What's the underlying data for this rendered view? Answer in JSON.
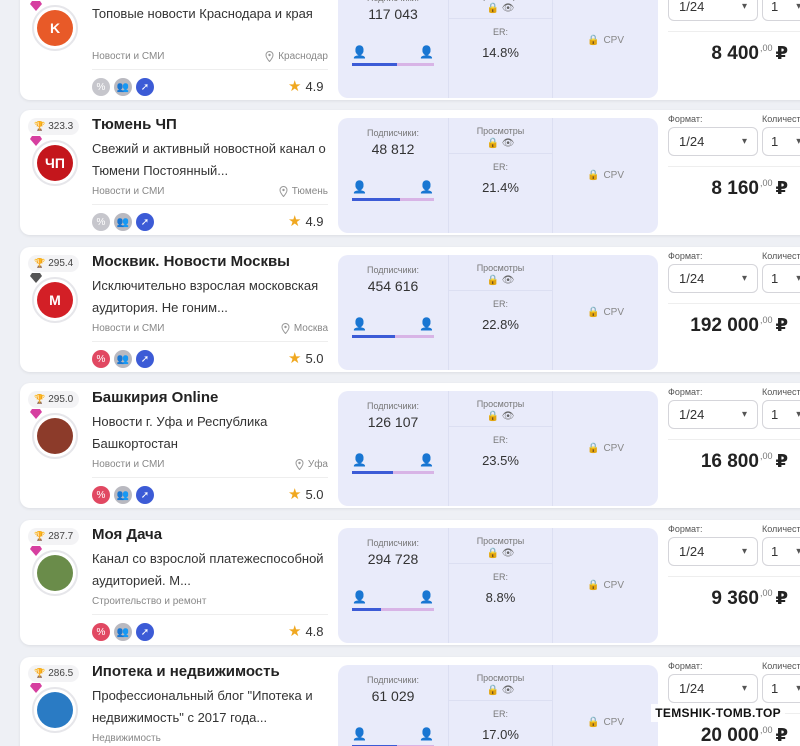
{
  "labels": {
    "subscribers": "Подписчики:",
    "views": "Просмотры",
    "er": "ER:",
    "cpv": "CPV",
    "format": "Формат:",
    "quantity": "Количество"
  },
  "currency": "₽",
  "watermark": "TEMSHIK-TOMB.TOP",
  "colors": {
    "accent": "#3c5bd6",
    "pink": "#c061c9",
    "stats_bg": "#e9ebfa",
    "discount_red": "#e14862"
  },
  "cards": [
    {
      "rank": "",
      "title": "",
      "description": "Топовые новости Краснодара и края",
      "category": "Новости и СМИ",
      "city": "Краснодар",
      "rating": "4.9",
      "discount_active": false,
      "subscribers": "117 043",
      "male_share": 0.55,
      "er": "14.8%",
      "format": "1/24",
      "quantity": "1",
      "price_main": "8 400",
      "price_cents": ",00",
      "avatar_text": "K",
      "avatar_color": "#e85a28"
    },
    {
      "rank": "323.3",
      "title": "Тюмень ЧП",
      "description": "Свежий и активный новостной канал о Тюмени Постоянный...",
      "category": "Новости и СМИ",
      "city": "Тюмень",
      "rating": "4.9",
      "discount_active": false,
      "subscribers": "48 812",
      "male_share": 0.58,
      "er": "21.4%",
      "format": "1/24",
      "quantity": "1",
      "price_main": "8 160",
      "price_cents": ",00",
      "avatar_text": "ЧП",
      "avatar_color": "#c4161c"
    },
    {
      "rank": "295.4",
      "title": "Москвик. Новости Москвы",
      "description": "Исключительно взрослая московская аудитория. Не гоним...",
      "category": "Новости и СМИ",
      "city": "Москва",
      "rating": "5.0",
      "discount_active": true,
      "subscribers": "454 616",
      "male_share": 0.52,
      "er": "22.8%",
      "format": "1/24",
      "quantity": "1",
      "price_main": "192 000",
      "price_cents": ",00",
      "avatar_text": "M",
      "avatar_color": "#d31f26"
    },
    {
      "rank": "295.0",
      "title": "Башкирия Online",
      "description": "Новости г. Уфа и Республика Башкортостан",
      "category": "Новости и СМИ",
      "city": "Уфа",
      "rating": "5.0",
      "discount_active": true,
      "subscribers": "126 107",
      "male_share": 0.5,
      "er": "23.5%",
      "format": "1/24",
      "quantity": "1",
      "price_main": "16 800",
      "price_cents": ",00",
      "avatar_text": "",
      "avatar_color": "#8c3b2a"
    },
    {
      "rank": "287.7",
      "title": "Моя Дача",
      "description": "Канал со взрослой платежеспособной аудиторией. М...",
      "category": "Строительство и ремонт",
      "city": "",
      "rating": "4.8",
      "discount_active": true,
      "subscribers": "294 728",
      "male_share": 0.35,
      "er": "8.8%",
      "format": "1/24",
      "quantity": "1",
      "price_main": "9 360",
      "price_cents": ",00",
      "avatar_text": "",
      "avatar_color": "#6a8c4a"
    },
    {
      "rank": "286.5",
      "title": "Ипотека и недвижимость",
      "description": "Профессиональный блог \"Ипотека и недвижимость\" с 2017 года...",
      "category": "Недвижимость",
      "city": "",
      "rating": "",
      "discount_active": false,
      "subscribers": "61 029",
      "male_share": 0.55,
      "er": "17.0%",
      "format": "1/24",
      "quantity": "1",
      "price_main": "20 000",
      "price_cents": ",00",
      "avatar_text": "",
      "avatar_color": "#2a7bc4"
    }
  ]
}
